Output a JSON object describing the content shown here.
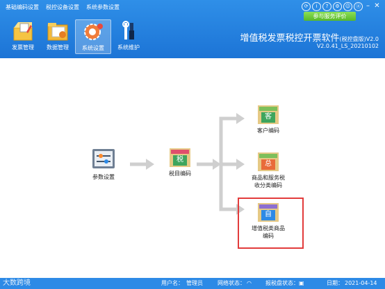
{
  "topmenu": [
    "基础编码设置",
    "税控设备设置",
    "系统参数设置"
  ],
  "eval_button": "参与服务评价",
  "toolbar": [
    {
      "label": "发票管理",
      "icon": "invoice-box-icon"
    },
    {
      "label": "数据管理",
      "icon": "folder-data-icon"
    },
    {
      "label": "系统设置",
      "icon": "gear-settings-icon"
    },
    {
      "label": "系统维护",
      "icon": "tools-icon"
    }
  ],
  "app": {
    "title": "增值税发票税控开票软件",
    "edition": "(税控盘版)",
    "version_suffix": "V2.0",
    "version": "V2.0.41_LS_20210102"
  },
  "nodes": {
    "params": "参数设置",
    "tax_code": "税目编码",
    "tax_badge": "税",
    "customer": "客户编码",
    "customer_badge": "客",
    "goods": "商品和服务税收分类编码",
    "goods_line1": "商品和服务税",
    "goods_line2": "收分类编码",
    "goods_badge": "总",
    "vat_line1": "增值税类商品",
    "vat_line2": "编码",
    "vat_badge": "自"
  },
  "status": {
    "user_label": "用户名：",
    "user": "管理员",
    "network_label": "网络状态：",
    "disk_label": "报税盘状态：",
    "date_label": "日期：",
    "date": "2021-04-14"
  },
  "watermark": "大数跨境",
  "colors": {
    "header": "#1c74d6",
    "active_tab": "#4a9ae9",
    "eval_green": "#57b82a",
    "highlight": "#e23b3b",
    "arrow": "#cfcfcf"
  }
}
